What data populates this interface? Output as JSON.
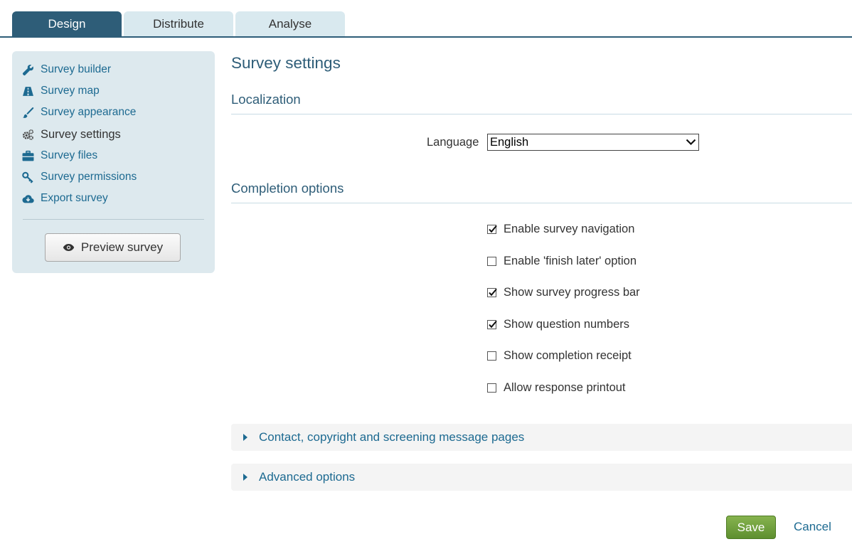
{
  "tabs": [
    {
      "label": "Design",
      "active": true
    },
    {
      "label": "Distribute",
      "active": false
    },
    {
      "label": "Analyse",
      "active": false
    }
  ],
  "sidebar": {
    "items": [
      {
        "label": "Survey builder",
        "icon": "wrench-icon"
      },
      {
        "label": "Survey map",
        "icon": "road-icon"
      },
      {
        "label": "Survey appearance",
        "icon": "brush-icon"
      },
      {
        "label": "Survey settings",
        "icon": "gears-icon",
        "current": true
      },
      {
        "label": "Survey files",
        "icon": "briefcase-icon"
      },
      {
        "label": "Survey permissions",
        "icon": "key-icon"
      },
      {
        "label": "Export survey",
        "icon": "cloud-download-icon"
      }
    ],
    "preview_label": "Preview survey",
    "preview_icon": "eye-icon"
  },
  "main": {
    "title": "Survey settings",
    "localization": {
      "heading": "Localization",
      "language_label": "Language",
      "language_value": "English"
    },
    "completion": {
      "heading": "Completion options",
      "options": [
        {
          "label": "Enable survey navigation",
          "checked": true
        },
        {
          "label": "Enable 'finish later' option",
          "checked": false
        },
        {
          "label": "Show survey progress bar",
          "checked": true
        },
        {
          "label": "Show question numbers",
          "checked": true
        },
        {
          "label": "Show completion receipt",
          "checked": false
        },
        {
          "label": "Allow response printout",
          "checked": false
        }
      ]
    },
    "accordions": [
      {
        "label": "Contact, copyright and screening message pages"
      },
      {
        "label": "Advanced options"
      }
    ],
    "save_label": "Save",
    "cancel_label": "Cancel"
  },
  "colors": {
    "accent": "#2e5d78",
    "link": "#1d6a91",
    "sidebar_bg": "#dde9ee",
    "save_green": "#6b9b3a"
  }
}
